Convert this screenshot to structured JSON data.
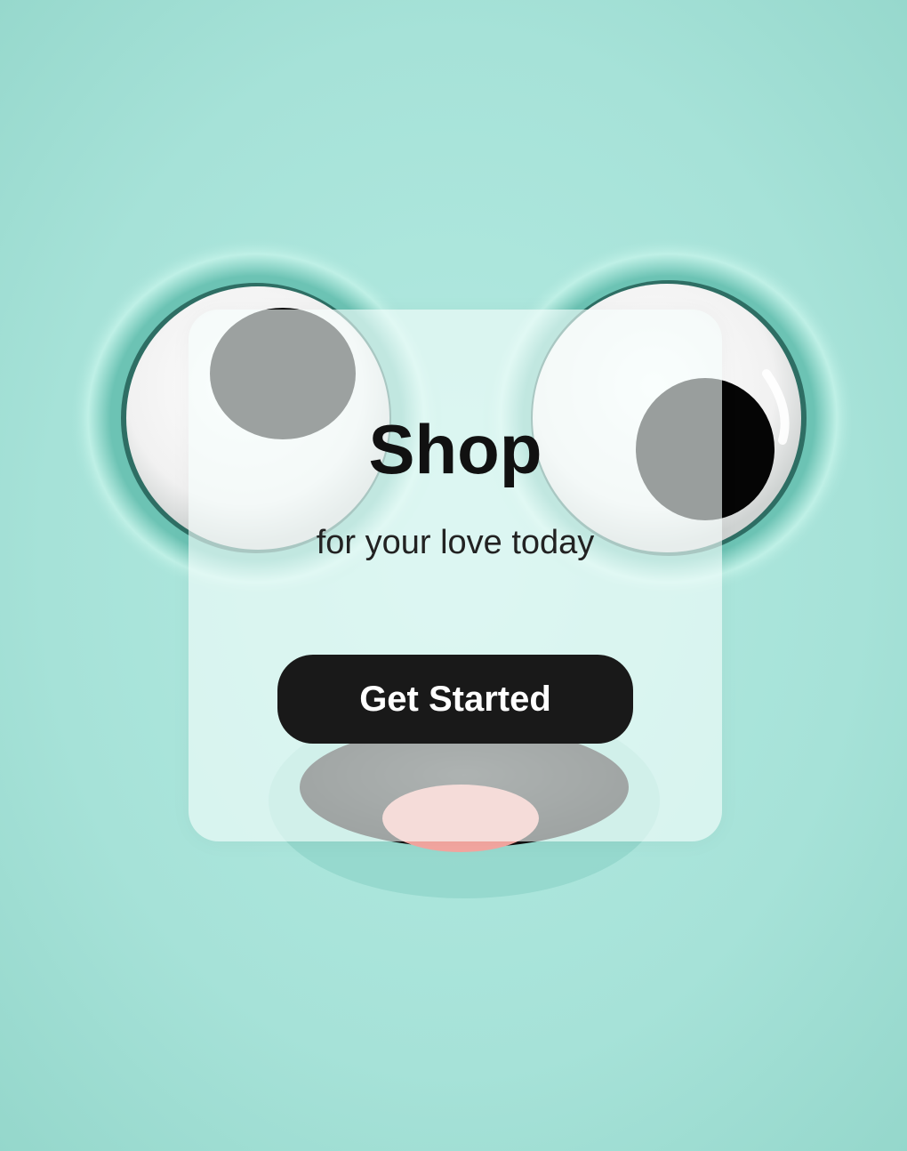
{
  "hero": {
    "title": "Shop",
    "subtitle": "for your love today",
    "cta_label": "Get Started"
  },
  "colors": {
    "background": "#a6e2d8",
    "button": "#191919",
    "button_text": "#ffffff",
    "title": "#111111"
  }
}
